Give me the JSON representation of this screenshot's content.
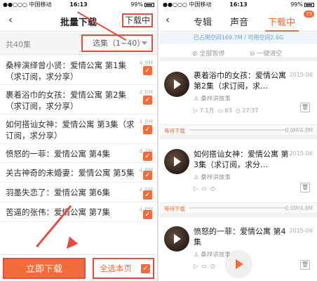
{
  "status": {
    "carrier": "●●○○○ 中国移动",
    "wifi_icon": "wifi-icon",
    "time": "16:13",
    "battery": "99%"
  },
  "left": {
    "header": {
      "title": "批量下载",
      "right_link": "下载中"
    },
    "filter": {
      "count": "共40集",
      "select_label": "选集（1~40）"
    },
    "episodes": [
      {
        "title": "桑梓演绎曾小贤：爱情公寓 第1集（求订阅，求分享）",
        "size": "4.9M",
        "checked": true
      },
      {
        "title": "裹着浴巾的女孩：爱情公寓 第2集（求订阅，求分享）",
        "size": "4.8M",
        "checked": true
      },
      {
        "title": "如何搭讪女神：爱情公寓 第3集（求订阅，求分享）",
        "size": "4.8M",
        "checked": true
      },
      {
        "title": "愤怒的一菲：爱情公寓 第4集",
        "size": "4.7M",
        "checked": true
      },
      {
        "title": "关古神奇的未婚妻：爱情公寓 第5集",
        "size": "4.8M",
        "checked": true
      },
      {
        "title": "羽墨失恋了：爱情公寓 第6集",
        "size": "4.8M",
        "checked": true
      },
      {
        "title": "苦逼的张伟：爱情公寓 第7集",
        "size": "4.8M",
        "checked": true
      }
    ],
    "footer": {
      "download_button": "立即下载",
      "select_all": "全选本页"
    }
  },
  "right": {
    "tabs": [
      {
        "label": "专辑"
      },
      {
        "label": "声音"
      },
      {
        "label": "下载中",
        "badge": "39"
      }
    ],
    "storage": "已占用空间169.7M / 可用空间2.6G",
    "actions": {
      "pause_all": "全部暂停",
      "clear_all": "一键清空"
    },
    "items": [
      {
        "title": "裹着浴巾的女孩：爱情公寓 第2集（求订阅，求…",
        "date": "2015-06",
        "author": "桑梓讲故事",
        "plays": "7.1万",
        "comments": "63",
        "duration": "27:37",
        "status": "等待下载",
        "size": "0.0M/4.8M"
      },
      {
        "title": "如何搭讪女神：爱情公寓 第3集（求订阅，求分…",
        "date": "2015-06",
        "author": "桑梓讲故事",
        "plays": "",
        "comments": "",
        "duration": "",
        "status": "等待下载",
        "size": "0.0M/4.8M"
      },
      {
        "title": "愤怒的一菲：爱情公寓 第4集",
        "date": "2015-06",
        "author": "桑梓讲故事",
        "plays": "",
        "comments": "",
        "duration": "",
        "status": "",
        "size": ""
      }
    ]
  },
  "colors": {
    "accent": "#f26b3a",
    "highlight": "#e74c3c",
    "info": "#6a9fd8"
  }
}
